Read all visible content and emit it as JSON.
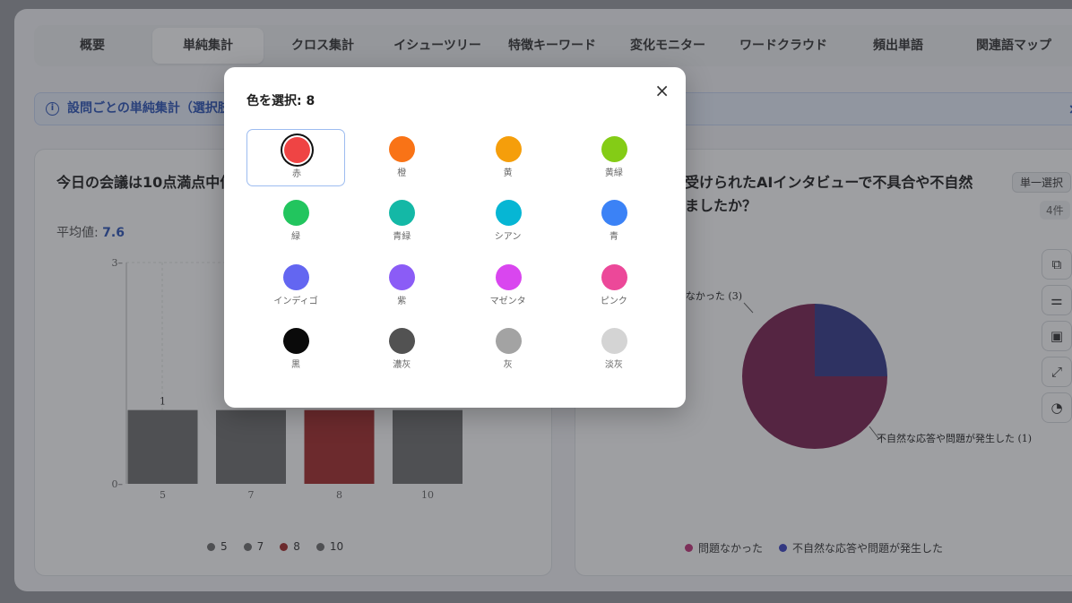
{
  "tabs": [
    "概要",
    "単純集計",
    "クロス集計",
    "イシューツリー",
    "特徴キーワード",
    "変化モニター",
    "ワードクラウド",
    "頻出単語",
    "関連語マップ"
  ],
  "active_tab": "単純集計",
  "info_bar": {
    "text": "設問ごとの単純集計（選択肢",
    "close": "×"
  },
  "left_card": {
    "title": "今日の会議は10点満点中何",
    "avg_label": "平均値: ",
    "avg_value": "7.6"
  },
  "right_card": {
    "title_line1": "受けられたAIインタビューで不具合や不自然",
    "title_line2": "ましたか？",
    "badge": "単一選択",
    "count": "4件"
  },
  "chart_data": [
    {
      "type": "bar",
      "categories": [
        "5",
        "7",
        "8",
        "10"
      ],
      "values": [
        1,
        1,
        1,
        1
      ],
      "data_labels": [
        "1",
        "",
        "",
        ""
      ],
      "ylim": [
        0,
        3
      ],
      "yticks": [
        "0",
        "3"
      ],
      "colors": [
        "#6f6f6f",
        "#6f6f6f",
        "#a42a2a",
        "#6f6f6f"
      ],
      "legend": [
        "5",
        "7",
        "8",
        "10"
      ],
      "legend_colors": [
        "#6f6f6f",
        "#6f6f6f",
        "#a42a2a",
        "#6f6f6f"
      ],
      "grid": true
    },
    {
      "type": "pie",
      "labels": [
        "問題なかった",
        "不自然な応答や問題が発生した"
      ],
      "values": [
        3,
        1
      ],
      "slice_labels": [
        "問題なかった (3)",
        "不自然な応答や問題が発生した (1)"
      ],
      "colors": [
        "#7b2150",
        "#333a8a"
      ],
      "legend_colors": [
        "#c2347a",
        "#3c44c4"
      ]
    }
  ],
  "modal": {
    "title": "色を選択: 8",
    "close": "×",
    "selected": "赤",
    "colors": [
      {
        "label": "赤",
        "hex": "#ef4444"
      },
      {
        "label": "橙",
        "hex": "#f97316"
      },
      {
        "label": "黄",
        "hex": "#f59e0b"
      },
      {
        "label": "黄緑",
        "hex": "#84cc16"
      },
      {
        "label": "緑",
        "hex": "#22c55e"
      },
      {
        "label": "青緑",
        "hex": "#14b8a6"
      },
      {
        "label": "シアン",
        "hex": "#06b6d4"
      },
      {
        "label": "青",
        "hex": "#3b82f6"
      },
      {
        "label": "インディゴ",
        "hex": "#6366f1"
      },
      {
        "label": "紫",
        "hex": "#8b5cf6"
      },
      {
        "label": "マゼンタ",
        "hex": "#d946ef"
      },
      {
        "label": "ピンク",
        "hex": "#ec4899"
      },
      {
        "label": "黒",
        "hex": "#0a0a0a"
      },
      {
        "label": "濃灰",
        "hex": "#525252"
      },
      {
        "label": "灰",
        "hex": "#a3a3a3"
      },
      {
        "label": "淡灰",
        "hex": "#d4d4d4"
      }
    ]
  }
}
